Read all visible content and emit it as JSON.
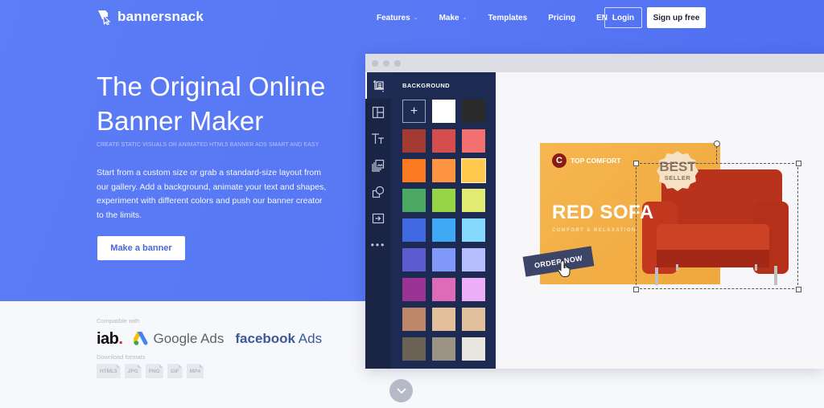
{
  "header": {
    "brand": "bannersnack",
    "nav": [
      {
        "label": "Features",
        "has_dropdown": true
      },
      {
        "label": "Make",
        "has_dropdown": true
      },
      {
        "label": "Templates",
        "has_dropdown": false
      },
      {
        "label": "Pricing",
        "has_dropdown": false
      },
      {
        "label": "EN",
        "has_dropdown": true
      }
    ],
    "login_label": "Login",
    "signup_label": "Sign up free"
  },
  "hero": {
    "title": "The Original Online Banner Maker",
    "subtitle": "CREATE STATIC VISUALS OR ANIMATED HTML5 BANNER ADS SMART AND EASY",
    "description": "Start from a custom size or grab a standard-size layout from our gallery. Add a background, animate your text and shapes, experiment with different colors and push our banner creator to the limits.",
    "cta_label": "Make a banner"
  },
  "compat": {
    "label": "Compatible with",
    "partners": {
      "iab": "iab",
      "iab_dot": ".",
      "google": "Google Ads",
      "facebook_bold": "facebook",
      "facebook_rest": " Ads"
    },
    "formats_label": "Download formats",
    "formats": [
      "HTML5",
      "JPG",
      "PNG",
      "GIF",
      "MP4"
    ]
  },
  "editor": {
    "tools": [
      "background-tool",
      "layout-tool",
      "text-tool",
      "media-tool",
      "shapes-tool",
      "export-tool",
      "more-tool"
    ],
    "active_tool": "background-tool",
    "panel_title": "BACKGROUND",
    "add_symbol": "+",
    "swatches": [
      "#ffffff",
      "#2a2a2a",
      "#a33b32",
      "#d54d4d",
      "#f46f6f",
      "#fa7a22",
      "#fd9441",
      "#fec94c",
      "#4ca963",
      "#96d545",
      "#e3ec72",
      "#4169e1",
      "#3fa9f5",
      "#84d9fd",
      "#5c5bd0",
      "#8098f7",
      "#b6bcfd",
      "#9b3395",
      "#dd6bb9",
      "#ecaef6",
      "#bd8669",
      "#e3bf9b",
      "#e2bf9d",
      "#6b6256",
      "#9b9384",
      "#e8e6df"
    ],
    "selected_swatch": "#fec94c",
    "banner": {
      "brand_initial": "C",
      "brand": "TOP COMFORT",
      "headline": "RED SOFA",
      "tagline": "COMFORT & RELAXATION",
      "badge_top": "BEST",
      "badge_bottom": "SELLER",
      "button": "ORDER NOW"
    }
  },
  "colors": {
    "hero_blue": "#5777f4",
    "editor_dark": "#1d2a52",
    "banner_orange": "#f3ae45"
  }
}
